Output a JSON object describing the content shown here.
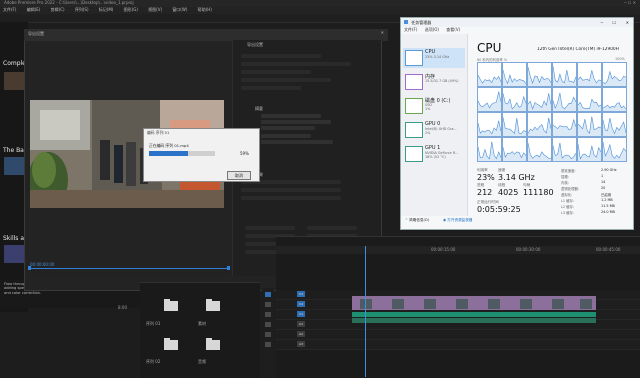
{
  "premiere": {
    "title": "Adobe Premiere Pro 2022 - C:\\Users\\...\\Desktop\\...\\video_1.prproj",
    "menu": [
      "文件(F)",
      "编辑(E)",
      "剪辑(C)",
      "序列(S)",
      "标记(M)",
      "图形(G)",
      "视图(V)",
      "窗口(W)",
      "帮助(H)"
    ],
    "learn": {
      "heading1": "Comple",
      "heading2": "The Ba",
      "heading3": "Skills ar",
      "bottom_text": "Flow through an end-to-end workflow with easy steps for adding speed, adding titles and transitions, adjusting audio, and color correction.",
      "duration": "8:00"
    },
    "export": {
      "title": "导出设置",
      "settings_header": "导出设置",
      "summary_header": "摘要",
      "effects_header": "效果",
      "preview_time": "00:00:00:00"
    },
    "progress": {
      "title": "编码 序列 01",
      "label": "正在编码 序列 01.mp4",
      "percent": "59%",
      "value": 0.59,
      "cancel_label": "取消"
    },
    "timeline": {
      "time1": "00:00:15:00",
      "time2": "00:00:30:00",
      "time3": "00:00:45:00",
      "tracks": [
        "V3",
        "V2",
        "V1",
        "A1",
        "A2",
        "A3"
      ]
    },
    "project": {
      "items": [
        "序列 01",
        "素材",
        "序列 02",
        "音频"
      ]
    }
  },
  "taskmgr": {
    "title": "任务管理器",
    "menu": [
      "文件(F)",
      "选项(O)",
      "查看(V)"
    ],
    "sidebar": [
      {
        "name": "CPU",
        "value": "23% 3.14 GHz"
      },
      {
        "name": "内存",
        "value": "15.5/31.7 GB (49%)"
      },
      {
        "name": "磁盘 0 (C:)",
        "value": "SSD\n1%"
      },
      {
        "name": "GPU 0",
        "value": "Intel(R) UHD Gra...\n2%"
      },
      {
        "name": "GPU 1",
        "value": "NVIDIA GeForce R...\n18% (52 °C)"
      }
    ],
    "header": "CPU",
    "cpu_model": "12th Gen Intel(R) Core(TM) i9-12900H",
    "graph_caption": "60 秒内的利用率 %",
    "graph_max": "100%",
    "stats": {
      "util_label": "利用率",
      "util_value": "23%",
      "speed_label": "速度",
      "speed_value": "3.14 GHz",
      "proc_label": "进程",
      "proc_value": "212",
      "thread_label": "线程",
      "thread_value": "4025",
      "handle_label": "句柄",
      "handle_value": "111180",
      "uptime_label": "正常运行时间",
      "uptime_value": "0:05:59:25"
    },
    "specs": [
      {
        "k": "基准速度:",
        "v": "2.90 GHz"
      },
      {
        "k": "插槽:",
        "v": "1"
      },
      {
        "k": "内核:",
        "v": "14"
      },
      {
        "k": "逻辑处理器:",
        "v": "20"
      },
      {
        "k": "虚拟化:",
        "v": "已启用"
      },
      {
        "k": "L1 缓存:",
        "v": "1.2 MB"
      },
      {
        "k": "L2 缓存:",
        "v": "11.5 MB"
      },
      {
        "k": "L3 缓存:",
        "v": "24.0 MB"
      }
    ],
    "footer_less": "简略信息(D)",
    "footer_monitor": "打开资源监视器",
    "accent": "#4a8fd8"
  }
}
